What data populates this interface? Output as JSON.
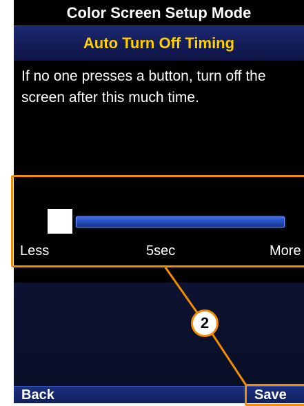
{
  "header": {
    "title": "Color Screen Setup Mode",
    "subtitle": "Auto Turn Off Timing"
  },
  "main": {
    "instruction": "If no one presses a button, turn off the screen after this much time."
  },
  "slider": {
    "min_label": "Less",
    "value_label": "5sec",
    "max_label": "More",
    "position": 0
  },
  "softkeys": {
    "back_label": "Back",
    "save_label": "Save"
  },
  "callout": {
    "number": "2"
  },
  "colors": {
    "title_text": "#ffffff",
    "subtitle_text": "#ffd000",
    "accent_blue": "#2348b8",
    "callout_orange": "#f28c00"
  }
}
